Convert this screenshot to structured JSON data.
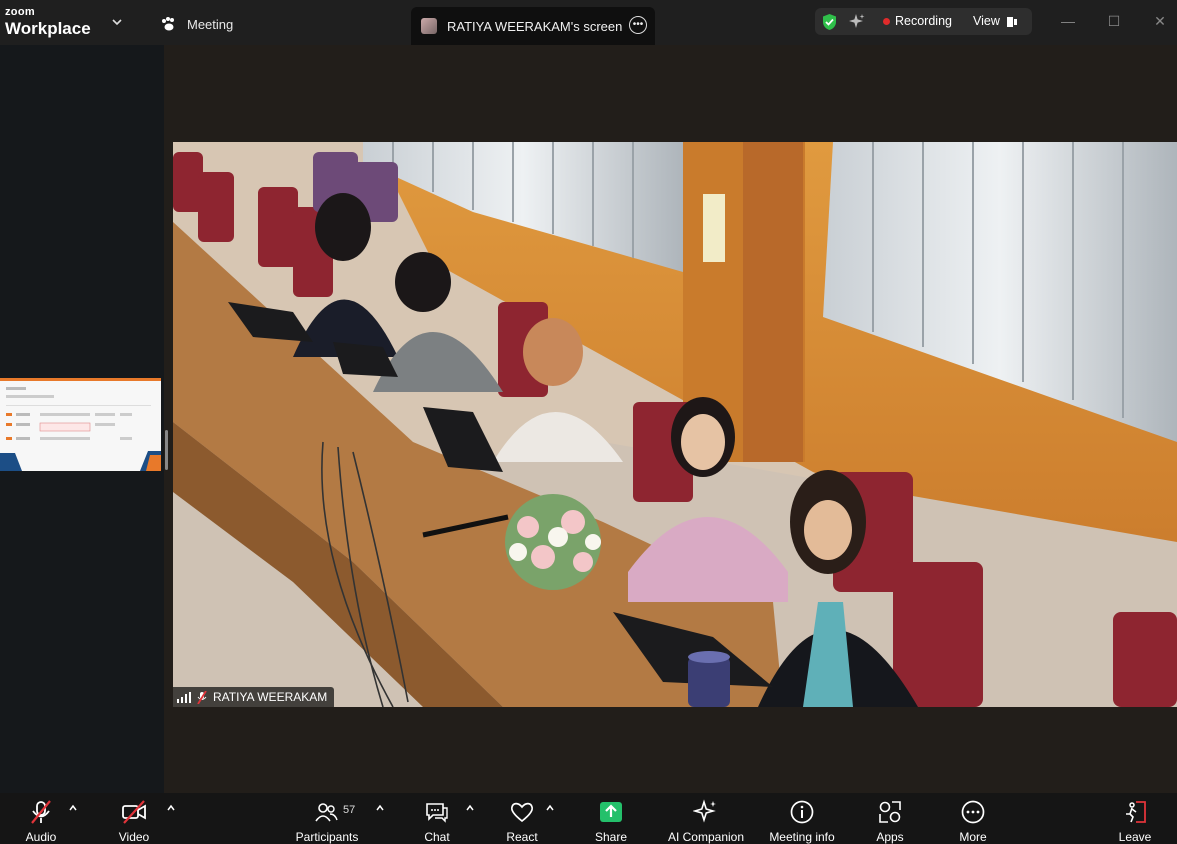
{
  "app": {
    "brand_top": "zoom",
    "brand_bottom": "Workplace"
  },
  "tabs": {
    "meeting_label": "Meeting",
    "screen_label": "RATIYA WEERAKAM's screen"
  },
  "status": {
    "recording_label": "Recording",
    "view_label": "View",
    "recording_color": "#e02b2b",
    "shield_color": "#2fbf4a"
  },
  "video": {
    "participant_name": "RATIYA WEERAKAM"
  },
  "toolbar": {
    "audio_label": "Audio",
    "video_label": "Video",
    "participants_label": "Participants",
    "participants_count": "57",
    "chat_label": "Chat",
    "react_label": "React",
    "share_label": "Share",
    "share_color": "#24c06b",
    "ai_label": "AI Companion",
    "info_label": "Meeting info",
    "apps_label": "Apps",
    "more_label": "More",
    "leave_label": "Leave",
    "leave_color": "#e0343a"
  }
}
